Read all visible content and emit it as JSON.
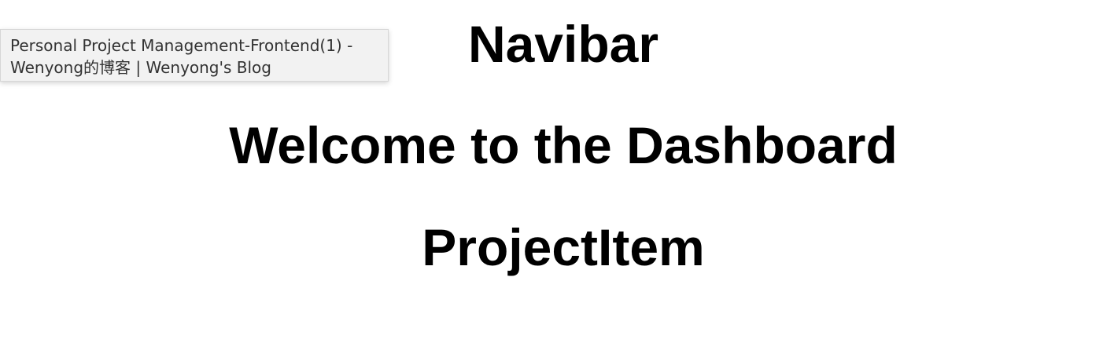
{
  "tooltip": {
    "line1": "Personal Project Management-Frontend(1) -",
    "line2": "Wenyong的博客 | Wenyong's Blog"
  },
  "main": {
    "navibar_heading": "Navibar",
    "dashboard_heading": "Welcome to the Dashboard",
    "project_item_heading": "ProjectItem"
  }
}
